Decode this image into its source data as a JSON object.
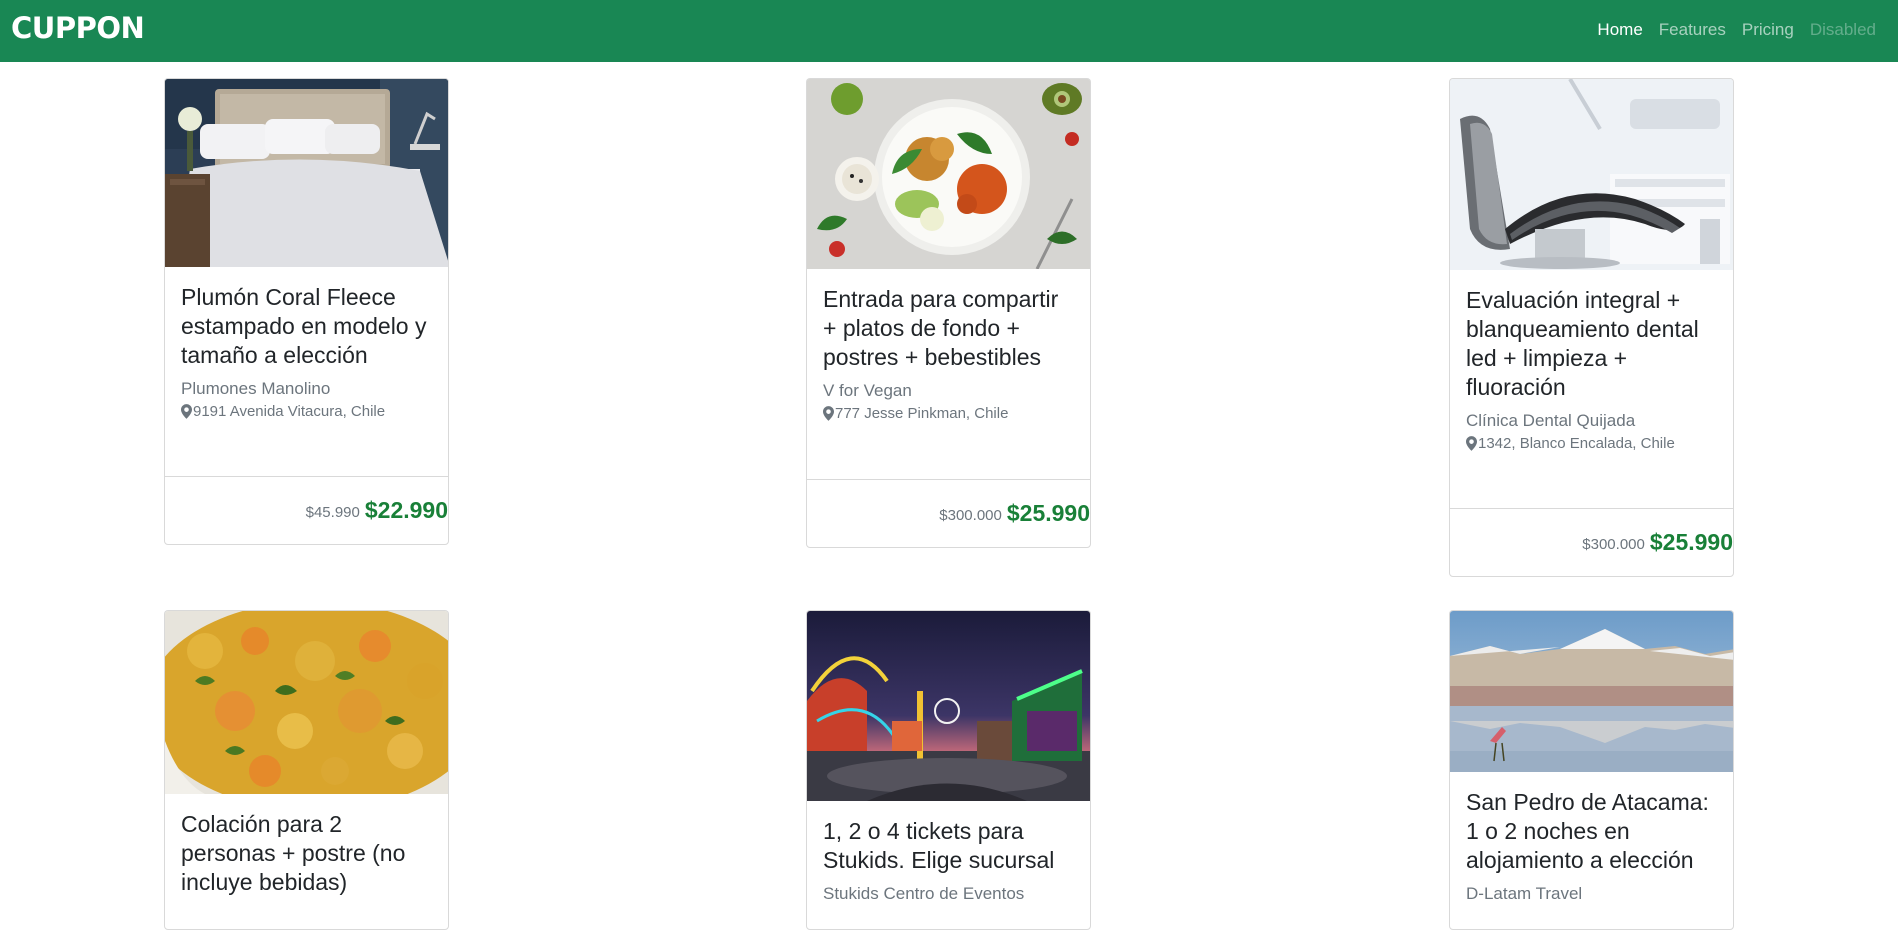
{
  "navbar": {
    "brand": "CUPPON",
    "links": [
      {
        "label": "Home"
      },
      {
        "label": "Features"
      },
      {
        "label": "Pricing"
      },
      {
        "label": "Disabled"
      }
    ]
  },
  "deals": [
    {
      "image": "bedroom-image",
      "title": "Plumón Coral Fleece estampado en modelo y tamaño a elección",
      "company": "Plumones Manolino",
      "address": "9191 Avenida Vitacura, Chile",
      "old_price": "$45.990",
      "new_price": "$22.990"
    },
    {
      "image": "vegan-food-image",
      "title": "Entrada para compartir + platos de fondo + postres + bebestibles",
      "company": "V for Vegan",
      "address": "777 Jesse Pinkman, Chile",
      "old_price": "$300.000",
      "new_price": "$25.990"
    },
    {
      "image": "dental-chair-image",
      "title": "Evaluación integral + blanqueamiento dental led + limpieza + fluoración",
      "company": "Clínica Dental Quijada",
      "address": "1342, Blanco Encalada, Chile",
      "old_price": "$300.000",
      "new_price": "$25.990"
    },
    {
      "image": "stew-food-image",
      "title": "Colación para 2 personas + postre (no incluye bebidas)"
    },
    {
      "image": "amusement-park-image",
      "title": "1, 2 o 4 tickets para Stukids. Elige sucursal",
      "company": "Stukids Centro de Eventos"
    },
    {
      "image": "atacama-landscape-image",
      "title": "San Pedro de Atacama: 1 o 2 noches en alojamiento a elección",
      "company": "D-Latam Travel"
    }
  ],
  "colors": {
    "navbar": "#198754",
    "price": "#198038",
    "muted": "#6c757d"
  }
}
